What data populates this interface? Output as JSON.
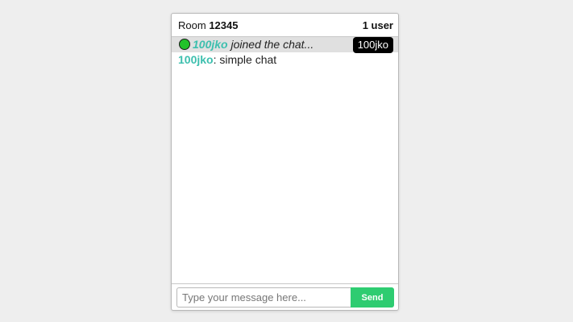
{
  "header": {
    "room_label": "Room",
    "room_id": "12345",
    "user_count": "1 user"
  },
  "messages": [
    {
      "type": "join",
      "user": "100jko",
      "text": "joined the chat...",
      "tooltip": "100jko",
      "status_icon": "online-dot-icon"
    },
    {
      "type": "chat",
      "user": "100jko",
      "separator": ":",
      "text": " simple chat"
    }
  ],
  "composer": {
    "placeholder": "Type your message here...",
    "value": "",
    "send_label": "Send"
  },
  "colors": {
    "username": "#3cbfae",
    "send_button": "#2ecc71",
    "online_dot": "#22c22a",
    "join_row_bg": "#e0e0e0"
  }
}
